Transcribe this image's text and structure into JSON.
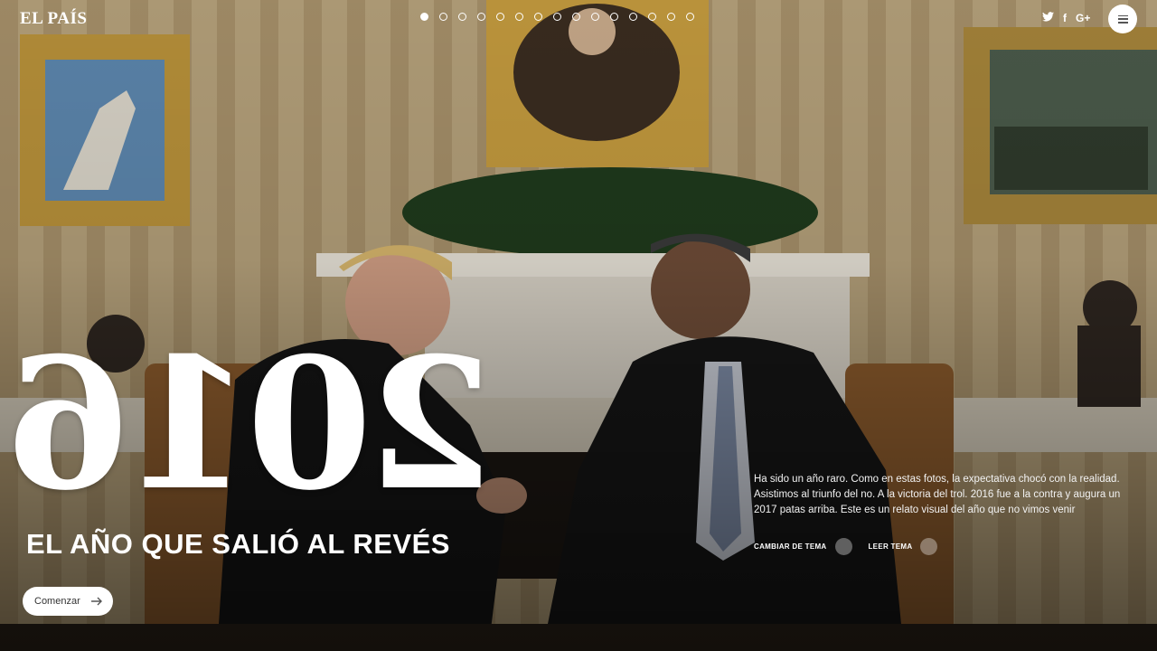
{
  "brand": {
    "logo": "EL PAÍS"
  },
  "slides": {
    "total": 15,
    "active_index": 0
  },
  "social": {
    "twitter": "🐦",
    "facebook": "f",
    "google_plus": "G+"
  },
  "hero": {
    "year": "2016",
    "subtitle": "EL AÑO QUE SALIÓ AL REVÉS",
    "start_label": "Comenzar"
  },
  "intro": {
    "text": "Ha sido un año raro. Como en estas fotos, la expectativa chocó con la realidad. Asistimos al triunfo del no. A la victoria del trol. 2016 fue a la contra y augura un 2017 patas arriba. Este es un relato visual del año que no vimos venir",
    "change_topic_label": "CAMBIAR DE TEMA",
    "read_topic_label": "LEER TEMA"
  }
}
